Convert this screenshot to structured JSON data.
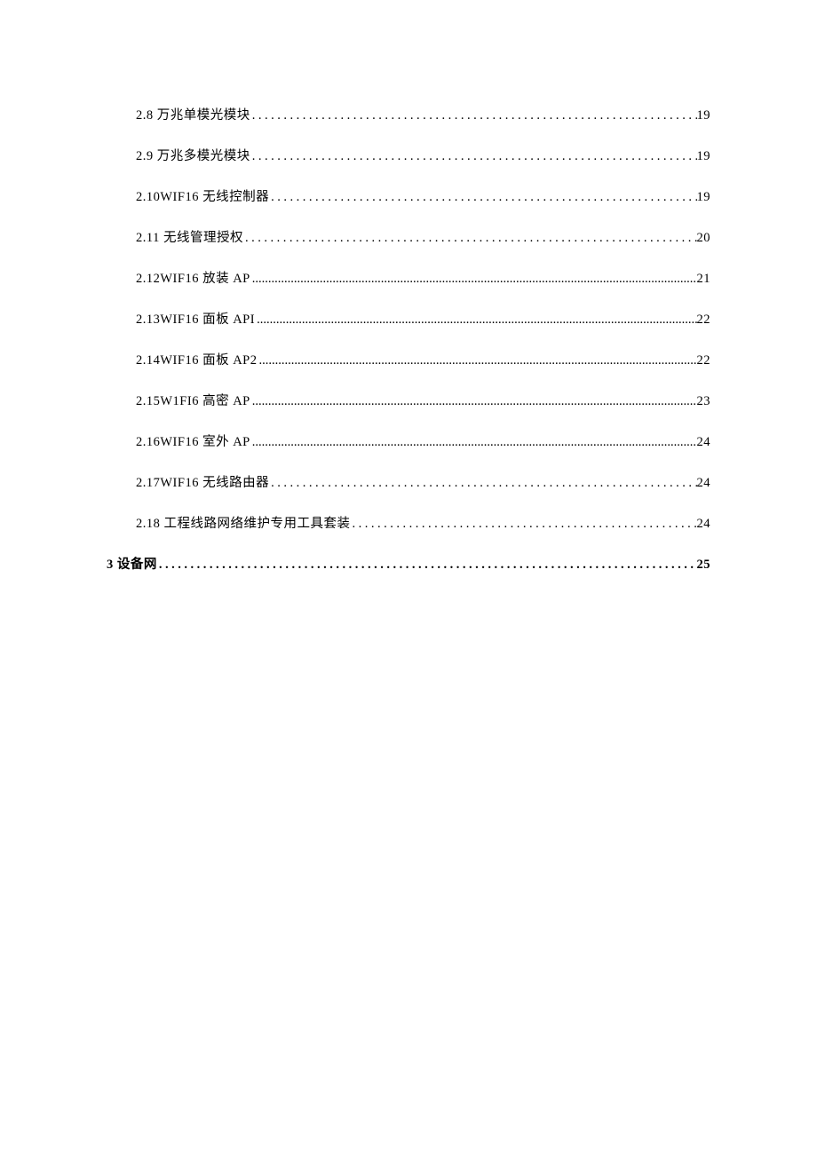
{
  "toc": {
    "entries": [
      {
        "text": "2.8 万兆单模光模块",
        "page": "19",
        "level": 2,
        "dotstyle": "wide"
      },
      {
        "text": "2.9 万兆多模光模块",
        "page": "19",
        "level": 2,
        "dotstyle": "wide"
      },
      {
        "text": "2.10WIF16 无线控制器",
        "page": "19",
        "level": 2,
        "dotstyle": "wide"
      },
      {
        "text": "2.11 无线管理授权",
        "page": "20",
        "level": 2,
        "dotstyle": "wide"
      },
      {
        "text": "2.12WIF16 放装 AP",
        "page": "21",
        "level": 2,
        "dotstyle": "tight"
      },
      {
        "text": "2.13WIF16 面板 API",
        "page": "22",
        "level": 2,
        "dotstyle": "tight"
      },
      {
        "text": "2.14WIF16 面板 AP2",
        "page": "22",
        "level": 2,
        "dotstyle": "tight"
      },
      {
        "text": "2.15W1FI6 高密 AP",
        "page": "23",
        "level": 2,
        "dotstyle": "tight"
      },
      {
        "text": "2.16WIF16 室外 AP",
        "page": "24",
        "level": 2,
        "dotstyle": "tight"
      },
      {
        "text": "2.17WIF16 无线路由器",
        "page": "24",
        "level": 2,
        "dotstyle": "wide"
      },
      {
        "text": "2.18 工程线路网络维护专用工具套装",
        "page": "24",
        "level": 2,
        "dotstyle": "wide"
      },
      {
        "text": "3 设备网",
        "page": "25",
        "level": 1,
        "dotstyle": "wide"
      }
    ]
  }
}
